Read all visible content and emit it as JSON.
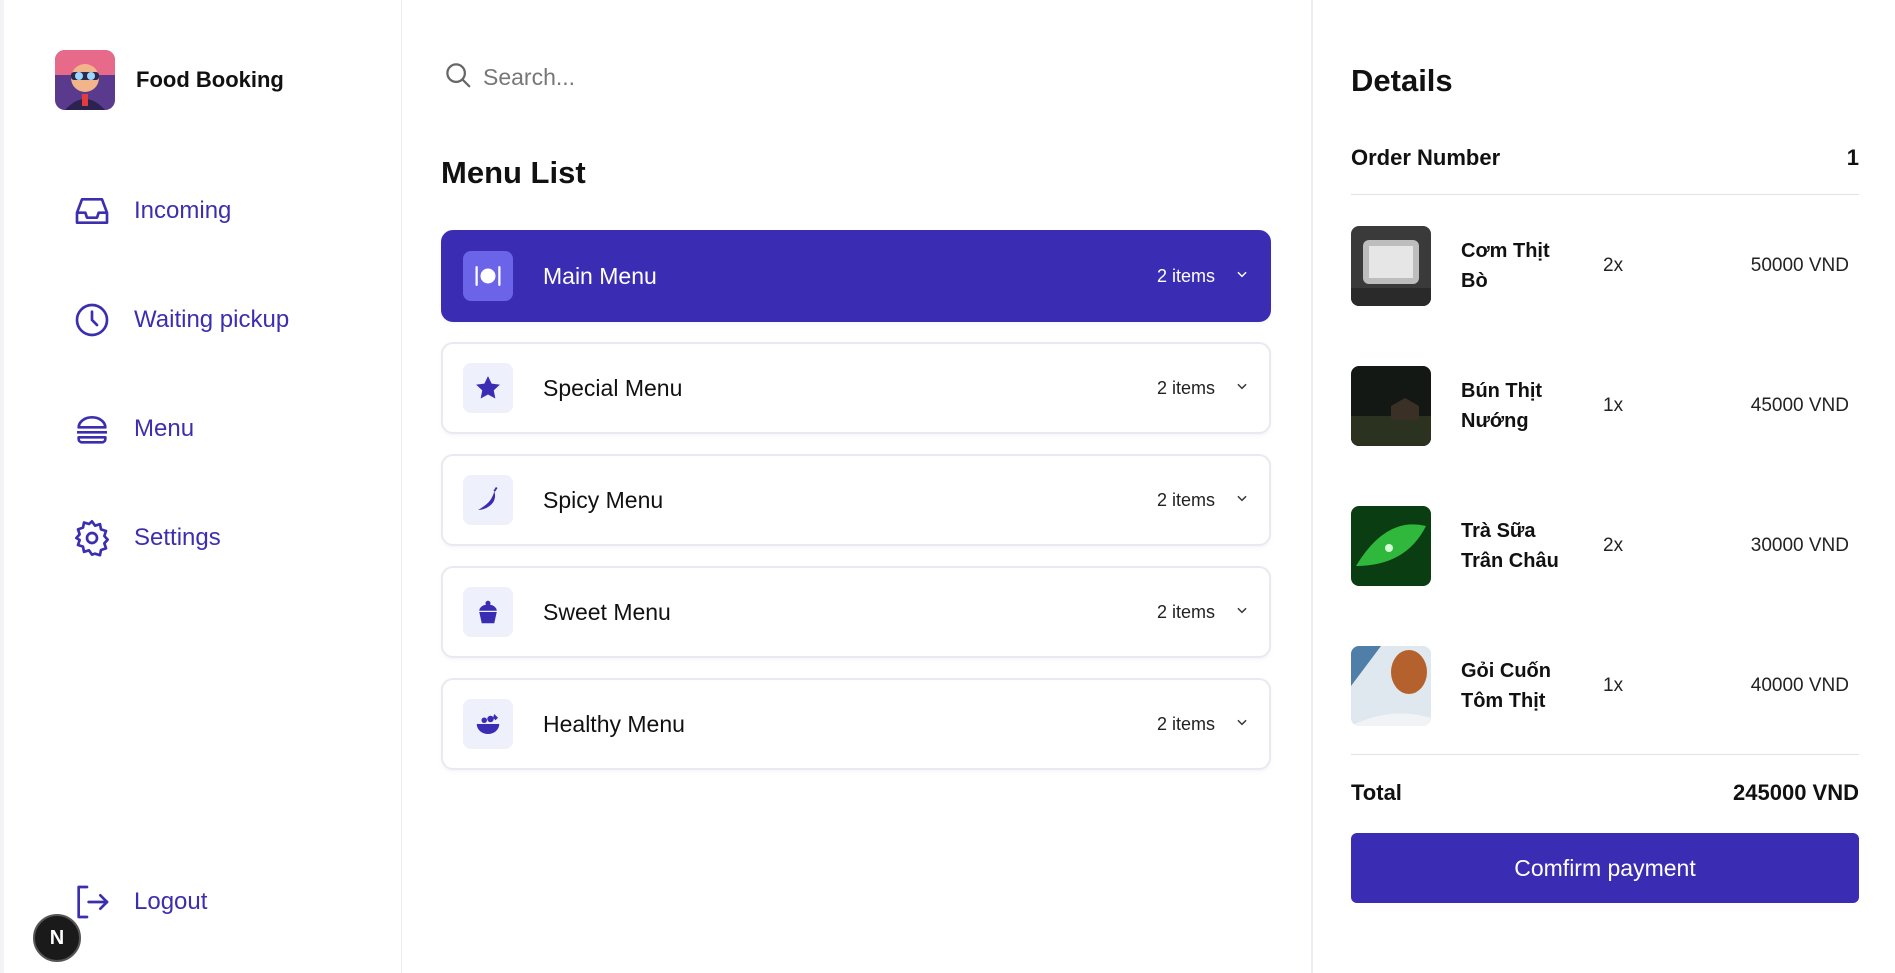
{
  "brand": {
    "name": "Food Booking"
  },
  "nav": [
    {
      "id": "incoming",
      "label": "Incoming",
      "icon": "inbox-icon"
    },
    {
      "id": "waiting",
      "label": "Waiting pickup",
      "icon": "clock-icon"
    },
    {
      "id": "menu",
      "label": "Menu",
      "icon": "burger-icon"
    },
    {
      "id": "settings",
      "label": "Settings",
      "icon": "gear-icon"
    }
  ],
  "logout": {
    "label": "Logout",
    "icon": "logout-icon"
  },
  "badge": {
    "letter": "N"
  },
  "search": {
    "placeholder": "Search..."
  },
  "menu_list": {
    "title": "Menu List",
    "items": [
      {
        "name": "Main Menu",
        "count": "2 items",
        "icon": "plate-icon",
        "active": true
      },
      {
        "name": "Special Menu",
        "count": "2 items",
        "icon": "star-icon",
        "active": false
      },
      {
        "name": "Spicy Menu",
        "count": "2 items",
        "icon": "chili-icon",
        "active": false
      },
      {
        "name": "Sweet Menu",
        "count": "2 items",
        "icon": "cupcake-icon",
        "active": false
      },
      {
        "name": "Healthy Menu",
        "count": "2 items",
        "icon": "salad-icon",
        "active": false
      }
    ]
  },
  "details": {
    "title": "Details",
    "order_label": "Order Number",
    "order_number": "1",
    "items": [
      {
        "name": "Cơm Thịt Bò",
        "qty": "2x",
        "price": "50000 VND"
      },
      {
        "name": "Bún Thịt Nướng",
        "qty": "1x",
        "price": "45000 VND"
      },
      {
        "name": "Trà Sữa Trân Châu",
        "qty": "2x",
        "price": "30000 VND"
      },
      {
        "name": "Gỏi Cuốn Tôm Thịt",
        "qty": "1x",
        "price": "40000 VND"
      }
    ],
    "total_label": "Total",
    "total_value": "245000 VND",
    "confirm_label": "Comfirm payment"
  },
  "colors": {
    "accent": "#3b2db3",
    "nav_text": "#3b2fb0",
    "icon_bg": "#eef0fb"
  }
}
